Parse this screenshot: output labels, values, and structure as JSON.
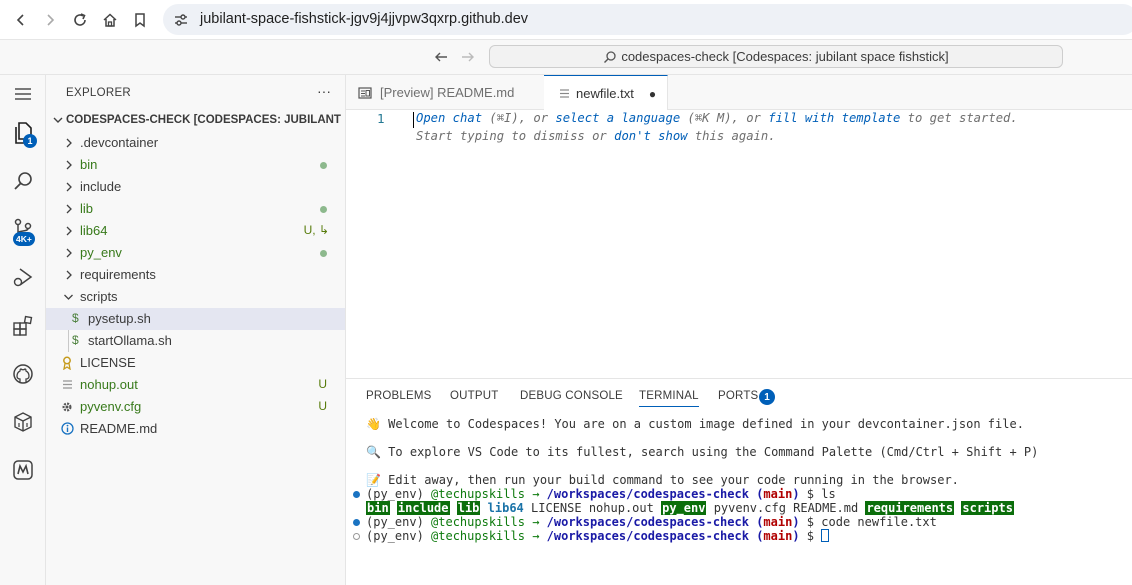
{
  "browser": {
    "url": "jubilant-space-fishstick-jgv9j4jjvpw3qxrp.github.dev"
  },
  "titlebar": {
    "command_center": "codespaces-check [Codespaces: jubilant space fishstick]"
  },
  "activity": {
    "explorer_badge": "1",
    "scm_badge": "4K+"
  },
  "explorer": {
    "title": "EXPLORER",
    "more": "···",
    "section": "CODESPACES-CHECK [CODESPACES: JUBILANT SPACE FISHSTICK]",
    "items": [
      {
        "label": ".devcontainer",
        "status": ""
      },
      {
        "label": "bin",
        "status": "dot"
      },
      {
        "label": "include",
        "status": ""
      },
      {
        "label": "lib",
        "status": "dot"
      },
      {
        "label": "lib64",
        "status": "U, ↳"
      },
      {
        "label": "py_env",
        "status": "dot"
      },
      {
        "label": "requirements",
        "status": ""
      },
      {
        "label": "scripts",
        "status": ""
      },
      {
        "label": "pysetup.sh",
        "status": ""
      },
      {
        "label": "startOllama.sh",
        "status": ""
      },
      {
        "label": "LICENSE",
        "status": ""
      },
      {
        "label": "nohup.out",
        "status": "U"
      },
      {
        "label": "pyvenv.cfg",
        "status": "U"
      },
      {
        "label": "README.md",
        "status": ""
      }
    ]
  },
  "tabs": [
    {
      "label": "[Preview] README.md"
    },
    {
      "label": "newfile.txt",
      "dirty": "●"
    }
  ],
  "editor": {
    "line_number": "1",
    "hint1": {
      "open_chat": "Open chat",
      "part1": " (⌘I), or ",
      "select_language": "select a language",
      "part2": " (⌘K M), or ",
      "fill_template": "fill with template",
      "part3": " to get started."
    },
    "hint2": {
      "part1": "Start typing to dismiss or ",
      "dont_show": "don't show",
      "part2": " this again."
    }
  },
  "panel": {
    "tabs": [
      "PROBLEMS",
      "OUTPUT",
      "DEBUG CONSOLE",
      "TERMINAL",
      "PORTS"
    ],
    "ports_badge": "1",
    "terminal": {
      "welcome": "👋 Welcome to Codespaces! You are on a custom image defined in your devcontainer.json file.",
      "explore": "🔍 To explore VS Code to its fullest, search using the Command Palette (Cmd/Ctrl + Shift + P)",
      "edit": "📝 Edit away, then run your build command to see your code running in the browser.",
      "env": "(py_env)",
      "user": "@techupskills",
      "arrow": "→",
      "path": "/workspaces/codespaces-check",
      "branch_open": "(",
      "branch": "main",
      "branch_close": ")",
      "prompt": "$",
      "cmd1": "ls",
      "ls": [
        "bin",
        "include",
        "lib",
        "lib64",
        "LICENSE",
        "nohup.out",
        "py_env",
        "pyvenv.cfg",
        "README.md",
        "requirements",
        "scripts"
      ],
      "cmd2": "code newfile.txt"
    }
  },
  "colors": {
    "accent": "#005fb8",
    "git_untracked": "#387a1b",
    "terminal_highlight": "#0b6e0b"
  }
}
